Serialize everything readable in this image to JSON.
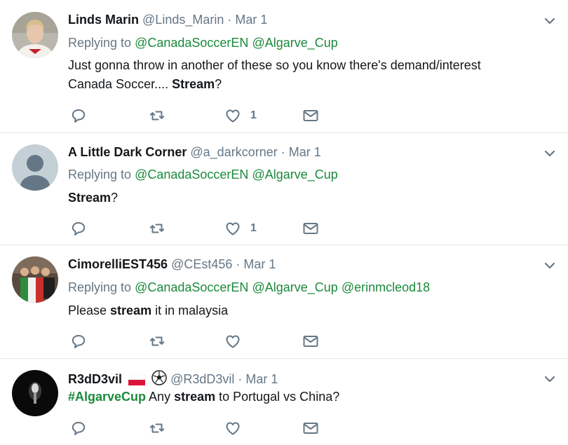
{
  "tweets": [
    {
      "name": "Linds Marin",
      "handle": "@Linds_Marin",
      "dot": "·",
      "date": "Mar 1",
      "replying_prefix": "Replying to",
      "reply_mentions": [
        "@CanadaSoccerEN",
        "@Algarve_Cup"
      ],
      "text_line1": "Just gonna throw in another of these so you know there's demand/interest",
      "text_line2_pre": "Canada Soccer.... ",
      "text_bold": "Stream",
      "text_post": "?",
      "like_count": "1"
    },
    {
      "name": "A Little Dark Corner",
      "handle": "@a_darkcorner",
      "dot": "·",
      "date": "Mar 1",
      "replying_prefix": "Replying to",
      "reply_mentions": [
        "@CanadaSoccerEN",
        "@Algarve_Cup"
      ],
      "text_bold": "Stream",
      "text_post": "?",
      "like_count": "1"
    },
    {
      "name": "CimorelliEST456",
      "handle": "@CEst456",
      "dot": "·",
      "date": "Mar 1",
      "replying_prefix": "Replying to",
      "reply_mentions": [
        "@CanadaSoccerEN",
        "@Algarve_Cup",
        "@erinmcleod18"
      ],
      "text_pre": "Please ",
      "text_bold": "stream",
      "text_post": " it in malaysia",
      "like_count": ""
    },
    {
      "name": "R3dD3vil",
      "handle": "@R3dD3vil",
      "dot": "·",
      "date": "Mar 1",
      "hashtag": "#AlgarveCup",
      "text_pre": " Any ",
      "text_bold": "stream",
      "text_post": " to Portugal vs China?",
      "like_count": ""
    }
  ],
  "colors": {
    "accent_green": "#1b8a3b",
    "muted": "#657786",
    "divider": "#e6ecf0"
  },
  "icons": [
    "reply-icon",
    "retweet-icon",
    "like-icon",
    "message-icon",
    "chevron-down-icon"
  ]
}
